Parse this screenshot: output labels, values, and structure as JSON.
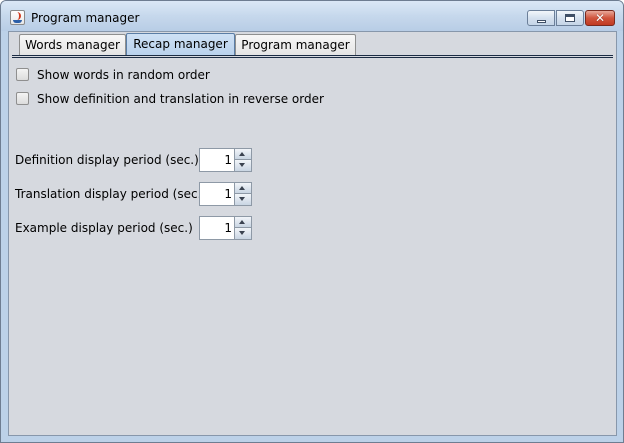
{
  "window": {
    "title": "Program manager"
  },
  "tabs": [
    {
      "label": "Words manager",
      "selected": false
    },
    {
      "label": "Recap manager",
      "selected": true
    },
    {
      "label": "Program manager",
      "selected": false
    }
  ],
  "options": [
    {
      "label": "Show words in random order",
      "checked": false
    },
    {
      "label": "Show definition and translation in reverse order",
      "checked": false
    }
  ],
  "periods": [
    {
      "label": "Definition display period (sec.)",
      "value": "1"
    },
    {
      "label": "Translation display period (sec.)",
      "value": "1"
    },
    {
      "label": "Example display period (sec.)",
      "value": "1"
    }
  ],
  "icons": {
    "app": "java-app-icon",
    "minimize": "minimize-icon",
    "maximize": "maximize-icon",
    "close": "close-icon",
    "spin_up": "arrow-up-icon",
    "spin_down": "arrow-down-icon"
  },
  "colors": {
    "close_button": "#c13a22",
    "selected_tab": "#b8d1ec",
    "panel_background": "#d6d9df"
  }
}
